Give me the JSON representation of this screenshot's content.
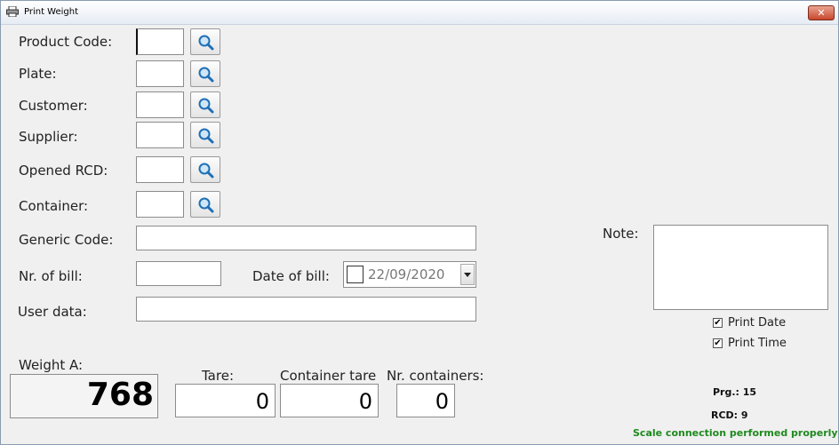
{
  "window": {
    "title": "Print Weight",
    "close_glyph": "✕"
  },
  "fields": [
    {
      "label": "Product Code:",
      "value": ""
    },
    {
      "label": "Plate:",
      "value": ""
    },
    {
      "label": "Customer:",
      "value": ""
    },
    {
      "label": "Supplier:",
      "value": ""
    },
    {
      "label": "Opened RCD:",
      "value": ""
    },
    {
      "label": "Container:",
      "value": ""
    }
  ],
  "generic_code": {
    "label": "Generic Code:",
    "value": ""
  },
  "bill": {
    "nr_label": "Nr. of bill:",
    "nr_value": "",
    "date_label": "Date of bill:",
    "date_value": "22/09/2020",
    "date_checked": false
  },
  "user_data": {
    "label": "User data:",
    "value": ""
  },
  "note": {
    "label": "Note:",
    "value": ""
  },
  "options": [
    {
      "label": "Print Date",
      "checked": true,
      "glyph": "✔"
    },
    {
      "label": "Print Time",
      "checked": true,
      "glyph": "✔"
    }
  ],
  "weight": {
    "label": "Weight A:",
    "value": "768"
  },
  "tare": {
    "label": "Tare:",
    "value": "0"
  },
  "container_tare": {
    "label": "Container tare",
    "value": "0"
  },
  "containers": {
    "label": "Nr. containers:",
    "value": "0"
  },
  "prg": "Prg.: 15",
  "rcd": "RCD: 9",
  "status": {
    "text": "Scale connection performed properly",
    "color": "#1e8a1e"
  },
  "icons": {
    "app": "printer-icon",
    "search": "search-icon"
  }
}
